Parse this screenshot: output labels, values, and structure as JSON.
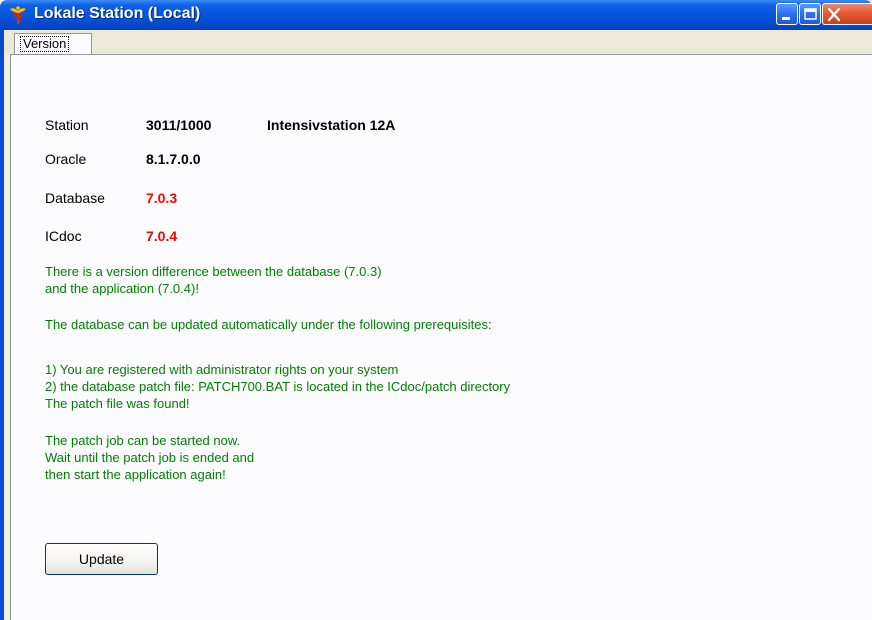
{
  "window": {
    "title": "Lokale Station (Local)",
    "icon": "caduceus-icon",
    "controls": [
      "minimize-icon",
      "maximize-icon",
      "close-icon"
    ]
  },
  "tabs": [
    {
      "label": "Version",
      "active": true
    }
  ],
  "info": {
    "station_label": "Station",
    "station_number": "3011/1000",
    "station_name": "Intensivstation 12A",
    "oracle_label": "Oracle",
    "oracle_version": "8.1.7.0.0",
    "database_label": "Database",
    "database_version": "7.0.3",
    "icdoc_label": "ICdoc",
    "icdoc_version": "7.0.4"
  },
  "messages": {
    "diff_line1": "There is a version difference between the database (7.0.3)",
    "diff_line2": "and the application (7.0.4)!",
    "prereq_intro": "The database can be updated automatically under the following prerequisites:",
    "prereq1": "1) You are registered with administrator rights on your system",
    "prereq2": "2) the database patch file: PATCH700.BAT is located in the ICdoc/patch directory",
    "patch_found": "The patch file was found!",
    "start_line1": "The patch job can be started now.",
    "start_line2": "Wait until the patch job is ended and",
    "start_line3": "then start the application again!"
  },
  "buttons": {
    "update": "Update"
  },
  "colors": {
    "titlebar": "#0453dc",
    "message_text": "#008000",
    "version_mismatch": "#ff0000"
  }
}
